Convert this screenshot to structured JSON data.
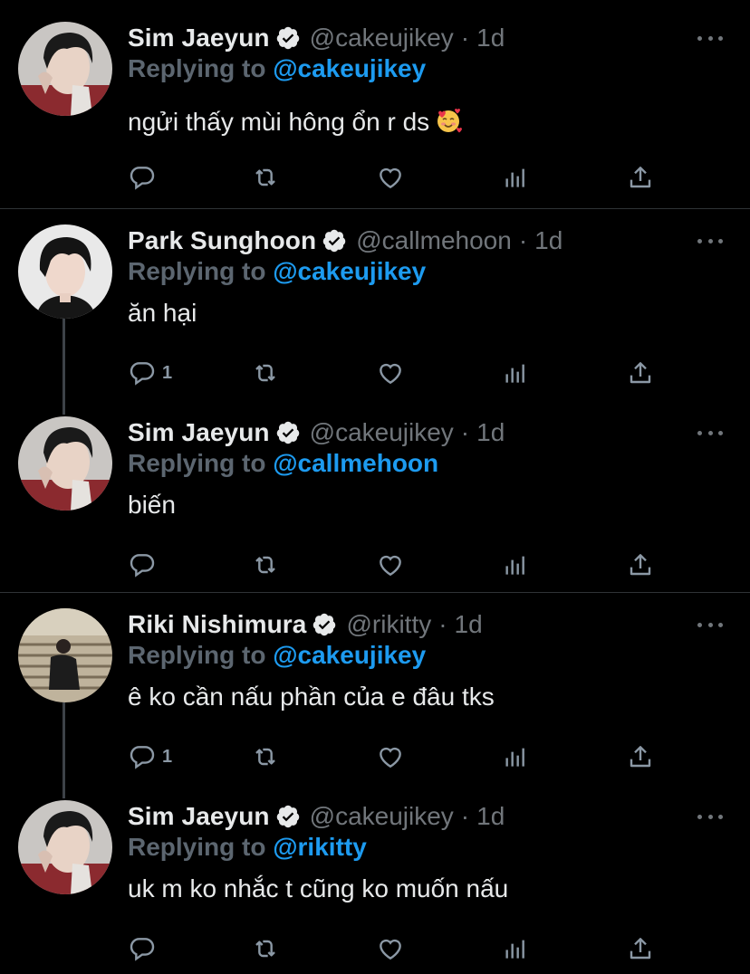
{
  "tweets": [
    {
      "name": "Sim Jaeyun",
      "handle": "@cakeujikey",
      "time": "1d",
      "replying_prefix": "Replying to",
      "replying_to": "@cakeujikey",
      "text": "ngửi thấy mùi hông ổn r ds",
      "emoji": "smiling-face-with-hearts",
      "reply_count": ""
    },
    {
      "name": "Park Sunghoon",
      "handle": "@callmehoon",
      "time": "1d",
      "replying_prefix": "Replying to",
      "replying_to": "@cakeujikey",
      "text": "ăn hại",
      "reply_count": "1"
    },
    {
      "name": "Sim Jaeyun",
      "handle": "@cakeujikey",
      "time": "1d",
      "replying_prefix": "Replying to",
      "replying_to": "@callmehoon",
      "text": "biến",
      "reply_count": ""
    },
    {
      "name": "Riki Nishimura",
      "handle": "@rikitty",
      "time": "1d",
      "replying_prefix": "Replying to",
      "replying_to": "@cakeujikey",
      "text": "ê ko cần nấu phần của e đâu tks",
      "reply_count": "1"
    },
    {
      "name": "Sim Jaeyun",
      "handle": "@cakeujikey",
      "time": "1d",
      "replying_prefix": "Replying to",
      "replying_to": "@rikitty",
      "text": "uk m ko nhắc t cũng ko muốn nấu",
      "reply_count": ""
    }
  ],
  "separator": "·",
  "icons": {
    "reply": "reply-icon",
    "retweet": "retweet-icon",
    "like": "heart-icon",
    "stats": "analytics-icon",
    "share": "share-icon",
    "verified": "verified-badge-icon",
    "more": "more-icon"
  },
  "colors": {
    "background": "#000000",
    "text": "#e7e9ea",
    "muted": "#71767b",
    "link": "#1d9bf0",
    "divider": "#2f3336"
  }
}
